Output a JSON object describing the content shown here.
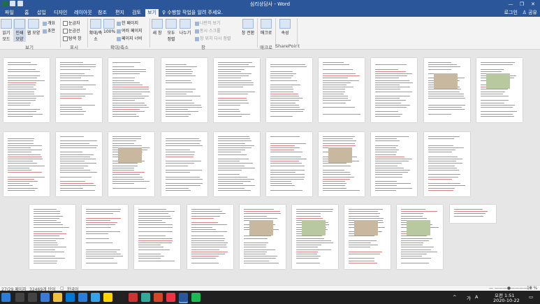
{
  "window": {
    "title": "심리상담사 - Word",
    "minimize": "—",
    "restore": "❐",
    "close": "✕"
  },
  "tabs": [
    {
      "label": "파일"
    },
    {
      "label": "홈"
    },
    {
      "label": "삽입"
    },
    {
      "label": "디자인"
    },
    {
      "label": "레이아웃"
    },
    {
      "label": "참조"
    },
    {
      "label": "편지"
    },
    {
      "label": "검토"
    },
    {
      "label": "보기"
    }
  ],
  "tellme": "♀ 수행할 작업을 알려 주세요.",
  "account": {
    "login": "로그인",
    "share": "♙ 공유"
  },
  "ribbon": {
    "view_group": {
      "read_mode": "읽기 모드",
      "print_layout": "인쇄 모양",
      "web_layout": "웹 모양",
      "outline": "개요",
      "draft": "초안",
      "label": "보기"
    },
    "show_group": {
      "ruler": "눈금자",
      "gridlines": "눈금선",
      "nav_pane": "탐색 창",
      "label": "표시"
    },
    "zoom_group": {
      "zoom": "확대/축소",
      "hundred": "100%",
      "one_page": "한 페이지",
      "multi_page": "여러 페이지",
      "page_width": "페이지 너비",
      "label": "확대/축소"
    },
    "window_group": {
      "new_window": "새 창",
      "arrange_all": "모두 정렬",
      "split": "나누기",
      "side_by_side": "나란히 보기",
      "sync_scroll": "동시 스크롤",
      "reset_pos": "창 위치 다시 정렬",
      "switch": "창 전환",
      "label": "창"
    },
    "macro_group": {
      "macro": "매크로",
      "label": "매크로"
    },
    "sp_group": {
      "props": "속성",
      "label": "SharePoint"
    }
  },
  "document": {
    "page1_title": "심리상담사 자격증 과정",
    "page_row_counts": [
      10,
      9,
      9
    ]
  },
  "status": {
    "page": "27/29 페이지",
    "words": "32469개 단어",
    "lang": "한국어",
    "zoom": "18 %"
  },
  "taskbar": {
    "time": "오전 1:51",
    "date": "2020-10-22",
    "ime": "가",
    "lang": "A"
  },
  "colors": {
    "word_blue": "#2b579a",
    "highlight_red": "#c0392b"
  }
}
